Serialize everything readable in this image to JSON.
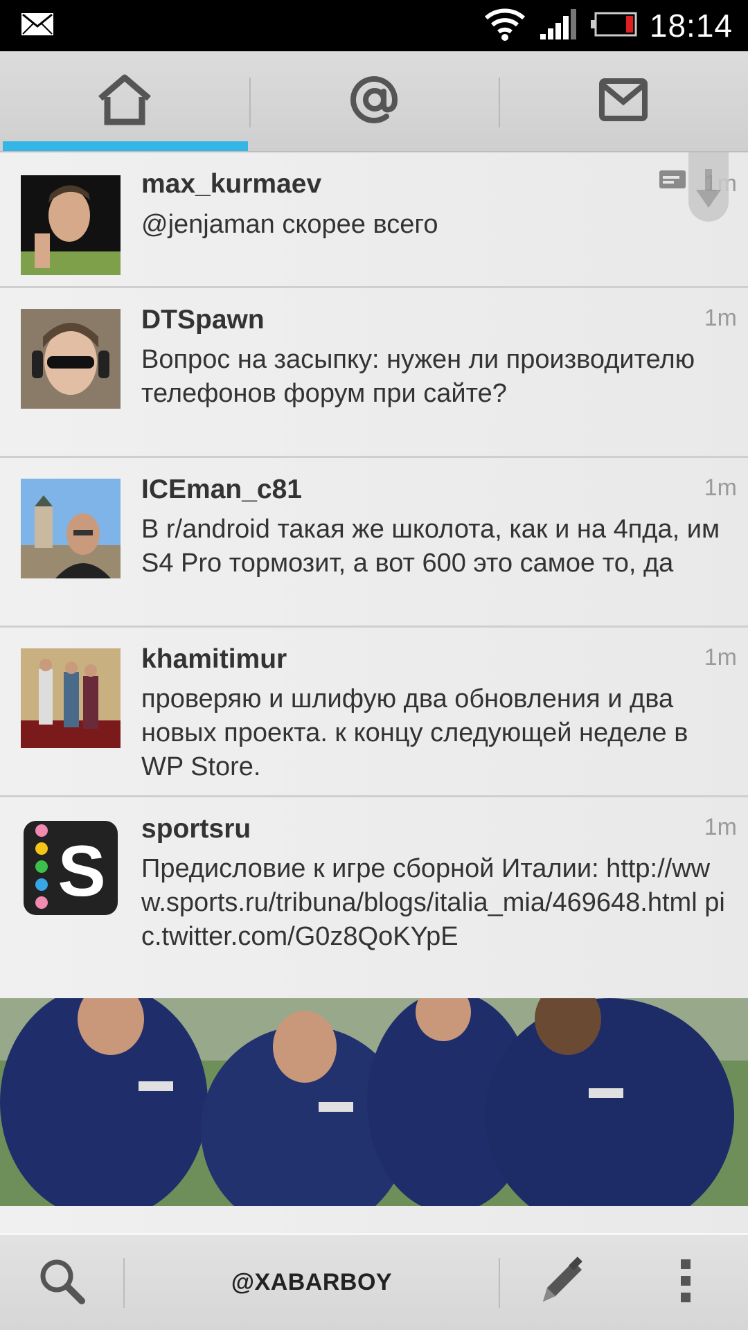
{
  "status_bar": {
    "time": "18:14",
    "icons": [
      "mail-notification-icon",
      "wifi-icon",
      "signal-icon",
      "battery-low-icon"
    ]
  },
  "tabs": [
    {
      "name": "home",
      "icon": "home-icon",
      "selected": true
    },
    {
      "name": "mentions",
      "icon": "at-sign-icon",
      "selected": false
    },
    {
      "name": "messages",
      "icon": "envelope-icon",
      "selected": false
    }
  ],
  "accent_color": "#33b5e5",
  "timeline": [
    {
      "user": "max_kurmaev",
      "time": "1m",
      "text": "@jenjaman скорее всего"
    },
    {
      "user": "DTSpawn",
      "time": "1m",
      "text": "Вопрос на засыпку: нужен ли производителю телефонов форум при сайте?"
    },
    {
      "user": "ICEman_c81",
      "time": "1m",
      "text": "В r/android такая же школота, как и на 4пда, им S4 Pro тормозит, а вот 600 это самое то, да"
    },
    {
      "user": "khamitimur",
      "time": "1m",
      "text": "проверяю и шлифую два обновления и два новых проекта. к концу следующей неделе в WP Store."
    },
    {
      "user": "sportsru",
      "time": "1m",
      "text": "Предисловие к игре сборной Италии: http://www.sports.ru/tribuna/blogs/italia_mia/469648.html pic.twitter.com/G0z8QoKYpE"
    }
  ],
  "bottom_bar": {
    "account": "@XABARBOY",
    "icons": [
      "search-icon",
      "compose-pencil-icon",
      "overflow-menu-icon"
    ]
  }
}
